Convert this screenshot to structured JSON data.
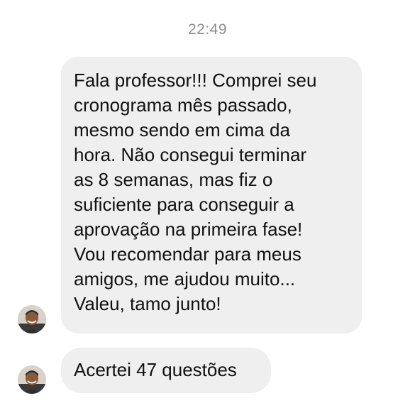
{
  "conversation": {
    "timestamp": "22:49",
    "messages": [
      {
        "sender_avatar": "person-avatar",
        "text": "Fala professor!!! Comprei seu\ncronograma mês passado,\nmesmo sendo em cima da\nhora. Não consegui terminar\nas 8 semanas, mas fiz o\nsuficiente para conseguir a\naprovação na primeira fase!\nVou recomendar para meus\namigos, me ajudou muito...\nValeu, tamo junto!"
      },
      {
        "sender_avatar": "person-avatar",
        "text": "Acertei 47 questões"
      }
    ]
  },
  "colors": {
    "bubble_background": "#efeff0",
    "timestamp_text": "#8e8e93",
    "message_text": "#111111"
  }
}
